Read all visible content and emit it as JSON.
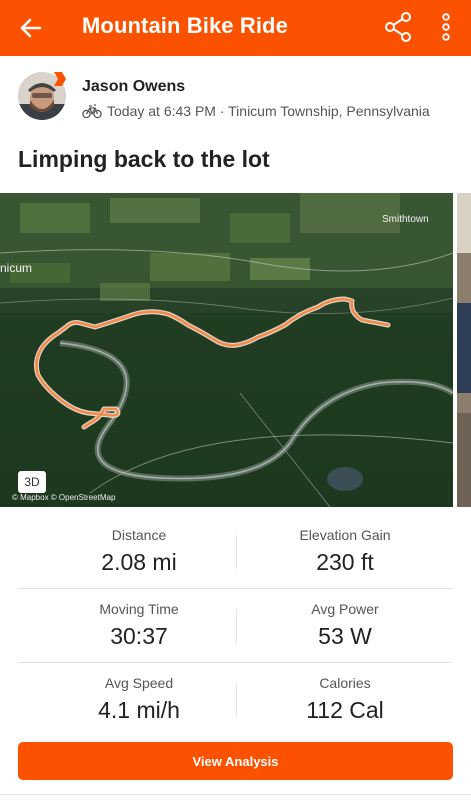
{
  "app_bar": {
    "title": "Mountain Bike Ride",
    "back_icon": "arrow-left-icon",
    "share_icon": "share-icon",
    "more_icon": "more-vertical-icon",
    "background": "#fc5200"
  },
  "athlete": {
    "name": "Jason Owens",
    "activity_icon": "mountain-bike-icon",
    "meta": "Today at 6:43 PM · Tinicum Township, Pennsylvania"
  },
  "activity": {
    "title": "Limping back to the lot"
  },
  "map": {
    "place_right": "Smithtown",
    "place_left": "nicum",
    "mode_button": "3D",
    "attribution": "© Mapbox © OpenStreetMap",
    "route_color": "#f5894a"
  },
  "stats": [
    {
      "label": "Distance",
      "value": "2.08 mi"
    },
    {
      "label": "Elevation Gain",
      "value": "230 ft"
    },
    {
      "label": "Moving Time",
      "value": "30:37"
    },
    {
      "label": "Avg Power",
      "value": "53 W"
    },
    {
      "label": "Avg Speed",
      "value": "4.1 mi/h"
    },
    {
      "label": "Calories",
      "value": "112 Cal"
    }
  ],
  "actions": {
    "view_analysis": "View Analysis"
  },
  "colors": {
    "accent": "#fc5200",
    "text": "#222222",
    "secondary_text": "#555555"
  }
}
